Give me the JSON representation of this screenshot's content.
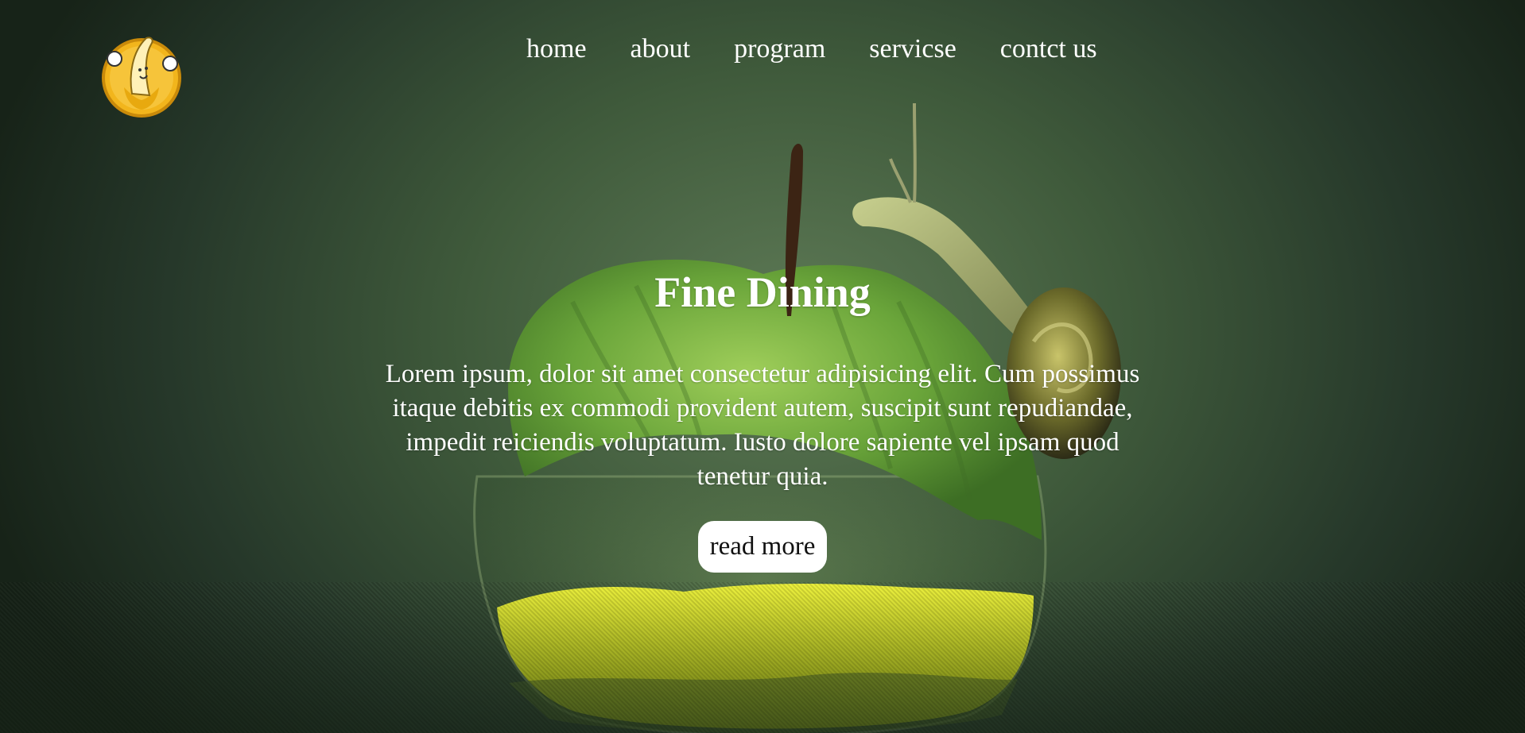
{
  "nav": {
    "items": [
      {
        "label": "home"
      },
      {
        "label": "about"
      },
      {
        "label": "program"
      },
      {
        "label": "servicse"
      },
      {
        "label": "contct us"
      }
    ]
  },
  "hero": {
    "title": "Fine Dining",
    "description": "Lorem ipsum, dolor sit amet consectetur adipisicing elit. Cum possimus itaque debitis ex commodi provident autem, suscipit sunt repudiandae, impedit reiciendis voluptatum. Iusto dolore sapiente vel ipsam quod tenetur quia.",
    "button_label": "read more"
  },
  "icons": {
    "logo": "banana-mascot-icon",
    "background": "apple-snail-photo"
  },
  "colors": {
    "background": "#3f5a3b",
    "text": "#ffffff",
    "button_bg": "#ffffff",
    "logo_yellow": "#f2b51c"
  }
}
